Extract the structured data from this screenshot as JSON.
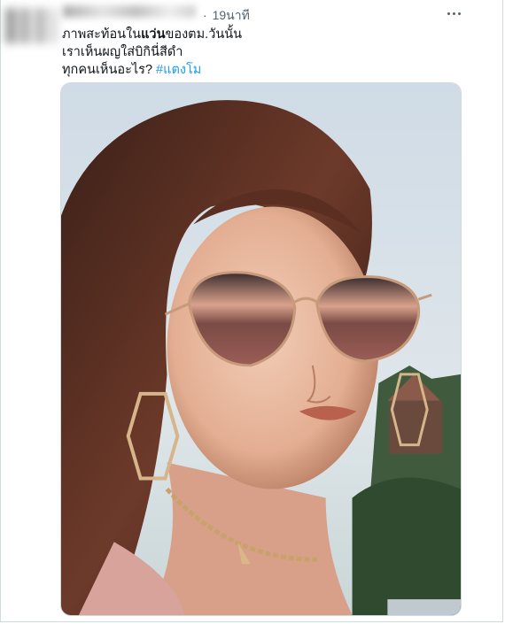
{
  "tweet": {
    "time_label": "19นาที",
    "time_separator": "·",
    "text_line1_a": "ภาพสะท้อนใน",
    "text_line1_bold": "แว่น",
    "text_line1_b": "ของตม.วันนั้น",
    "text_line2": "เราเห็นผญใส่บิกินี่สีดำ",
    "text_line3": "ทุกคนเห็นอะไร? ",
    "hashtag": "#แตงโม",
    "more_icon": "more-horizontal-icon"
  },
  "colors": {
    "text": "#0f1419",
    "secondary": "#536471",
    "link": "#1d9bf0",
    "border": "#cfd9de"
  }
}
